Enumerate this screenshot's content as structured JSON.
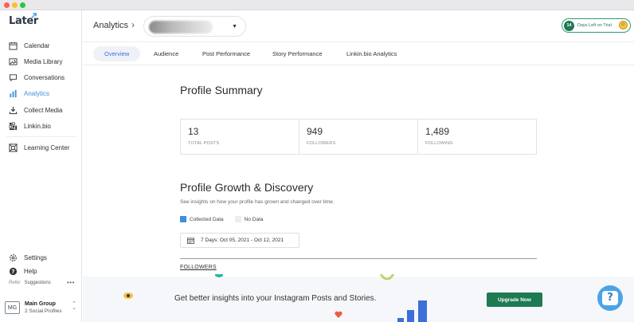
{
  "app": {
    "logo_text": "Later"
  },
  "sidebar": {
    "items": [
      {
        "label": "Calendar",
        "icon": "calendar-icon"
      },
      {
        "label": "Media Library",
        "icon": "image-icon"
      },
      {
        "label": "Conversations",
        "icon": "chat-icon"
      },
      {
        "label": "Analytics",
        "icon": "bar-chart-icon",
        "active": true
      },
      {
        "label": "Collect Media",
        "icon": "download-icon"
      },
      {
        "label": "Linkin.bio",
        "icon": "link-icon"
      },
      {
        "label": "Learning Center",
        "icon": "lifebuoy-icon"
      }
    ],
    "bottom_items": [
      {
        "label": "Settings",
        "icon": "gear-icon"
      },
      {
        "label": "Help",
        "icon": "question-icon"
      }
    ],
    "refer_label": "Refer",
    "suggestions_label": "Suggestions",
    "more_label": "•••",
    "group": {
      "badge": "MG",
      "name": "Main Group",
      "profiles": "2 Social Profiles"
    }
  },
  "header": {
    "title": "Analytics",
    "breadcrumb_separator": "›",
    "trial_days": "14",
    "trial_text": "Days Left on Trial"
  },
  "tabs": [
    {
      "label": "Overview",
      "active": true
    },
    {
      "label": "Audience"
    },
    {
      "label": "Post Performance"
    },
    {
      "label": "Story Performance"
    },
    {
      "label": "Linkin.bio Analytics"
    }
  ],
  "summary": {
    "heading": "Profile Summary",
    "stats": [
      {
        "value": "13",
        "label": "TOTAL POSTS"
      },
      {
        "value": "949",
        "label": "FOLLOWERS"
      },
      {
        "value": "1,489",
        "label": "FOLLOWING"
      }
    ]
  },
  "growth": {
    "heading": "Profile Growth & Discovery",
    "description": "See insights on how your profile has grown and changed over time.",
    "legend_collected": "Collected Data",
    "legend_no_data": "No Data",
    "date_range": "7 Days: Oct 05, 2021 - Oct 12, 2021",
    "followers_label": "FOLLOWERS"
  },
  "banner": {
    "text": "Get better insights into your Instagram Posts and Stories.",
    "button_label": "Upgrade Now"
  },
  "help_fab": {
    "glyph": "?"
  },
  "colors": {
    "accent": "#3d8fd9",
    "brand_green": "#1d7a52",
    "active_tab_text": "#3d6ed9"
  }
}
